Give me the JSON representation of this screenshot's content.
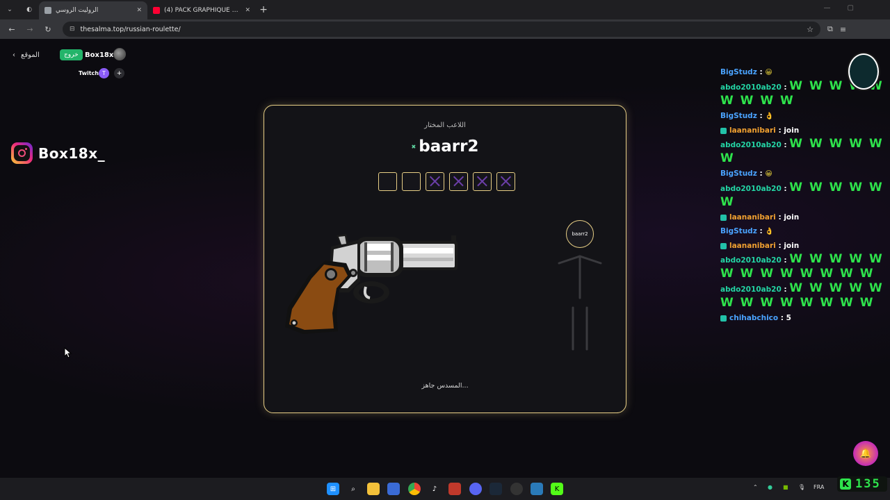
{
  "browser": {
    "tabs": [
      {
        "title": "الروليت الروسي",
        "active": true,
        "favicon_color": "#9aa0a6"
      },
      {
        "title": "(4) PACK GRAPHIQUE FIVEM 2...",
        "active": false,
        "favicon_color": "#ff0033"
      }
    ],
    "url": "thesalma.top/russian-roulette/"
  },
  "page": {
    "site_link": "الموقع",
    "logout_label": "خروج",
    "username": "Box18x",
    "twitch_label": "Twitch",
    "twitch_badge": "T",
    "plus_badge": "+",
    "instagram_handle": "Box18x_"
  },
  "game": {
    "selected_label": "اللاعب المختار",
    "selected_player": "baarr2",
    "chambers": [
      "empty",
      "empty",
      "spent",
      "spent",
      "spent",
      "spent"
    ],
    "player_avatar_name": "baarr2",
    "status": "المسدس جاهز..."
  },
  "chat": [
    {
      "user": "BigStudz",
      "color": "#4aa3ff",
      "badge": false,
      "text": "😀",
      "big": false
    },
    {
      "user": "abdo2010ab20",
      "color": "#23d4a4",
      "badge": false,
      "text": "W W W W W W W W W",
      "big": true
    },
    {
      "user": "BigStudz",
      "color": "#4aa3ff",
      "badge": false,
      "text": "👌",
      "big": false
    },
    {
      "user": "laananibari",
      "color": "#f0a030",
      "badge": true,
      "text": "join",
      "big": false
    },
    {
      "user": "abdo2010ab20",
      "color": "#23d4a4",
      "badge": false,
      "text": "W W W W W W",
      "big": true
    },
    {
      "user": "BigStudz",
      "color": "#4aa3ff",
      "badge": false,
      "text": "😀",
      "big": false
    },
    {
      "user": "abdo2010ab20",
      "color": "#23d4a4",
      "badge": false,
      "text": "W W W W W W",
      "big": true
    },
    {
      "user": "laananibari",
      "color": "#f0a030",
      "badge": true,
      "text": "join",
      "big": false
    },
    {
      "user": "BigStudz",
      "color": "#4aa3ff",
      "badge": false,
      "text": "👌",
      "big": false
    },
    {
      "user": "laananibari",
      "color": "#f0a030",
      "badge": true,
      "text": "join",
      "big": false
    },
    {
      "user": "abdo2010ab20",
      "color": "#23d4a4",
      "badge": false,
      "text": "W W W W W W W W W W W W W",
      "big": true
    },
    {
      "user": "abdo2010ab20",
      "color": "#23d4a4",
      "badge": false,
      "text": "W W W W W W W W W W W W W",
      "big": true
    },
    {
      "user": "chihabchico",
      "color": "#4aa3ff",
      "badge": true,
      "text": "5",
      "big": false
    }
  ],
  "overlay": {
    "counter_letter": "K",
    "counter_value": "135",
    "fab_icon": "bell-icon"
  },
  "taskbar": {
    "language": "FRA"
  },
  "colors": {
    "accent_gold": "#e8cf86",
    "logout_green": "#23b46a",
    "twitch_purple": "#8b5cf6",
    "chat_green": "#2ee34c"
  }
}
